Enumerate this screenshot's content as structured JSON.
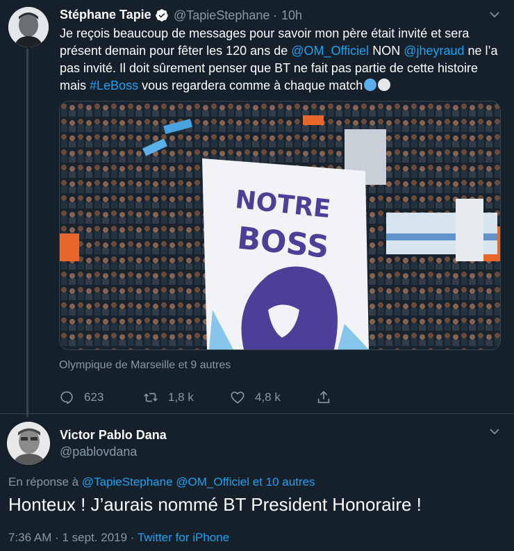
{
  "tweet1": {
    "author_name": "Stéphane Tapie",
    "handle": "@TapieStephane",
    "separator": "·",
    "time": "10h",
    "text_parts": {
      "p1": "Je reçois beaucoup de messages pour savoir mon père était invité et sera présent demain pour fêter les 120 ans de ",
      "mention1": "@OM_Officiel",
      "p2": " NON ",
      "mention2": "@jheyraud",
      "p3": " ne l’a pas invité. Il doit sûrement penser que BT ne fait pas partie de cette histoire mais ",
      "hashtag": "#LeBoss",
      "p4": " vous regardera comme à chaque match"
    },
    "emoji_colors": [
      "#5dadec",
      "#e6e7e8"
    ],
    "media": {
      "banner_line1": "NOTRE",
      "banner_line2": "BOSS"
    },
    "tagged": "Olympique de Marseille et 9 autres",
    "actions": {
      "replies": "623",
      "retweets": "1,8 k",
      "likes": "4,8 k"
    },
    "icons": [
      "verified-badge-icon",
      "chevron-down-icon",
      "reply-icon",
      "retweet-icon",
      "like-icon",
      "share-icon"
    ]
  },
  "tweet2": {
    "author_name": "Victor Pablo Dana",
    "handle": "@pablovdana",
    "reply_prefix": "En réponse à ",
    "reply_mention1": "@TapieStephane",
    "reply_mention2": "@OM_Officiel",
    "reply_others": "et 10 autres",
    "text": "Honteux ! J’aurais nommé BT President Honoraire !",
    "timestamp": "7:36 AM · 1 sept. 2019 · ",
    "source": "Twitter for iPhone"
  },
  "colors": {
    "background": "#15202b",
    "link": "#1da1f2",
    "muted": "#8899a6",
    "border": "#38444d"
  }
}
